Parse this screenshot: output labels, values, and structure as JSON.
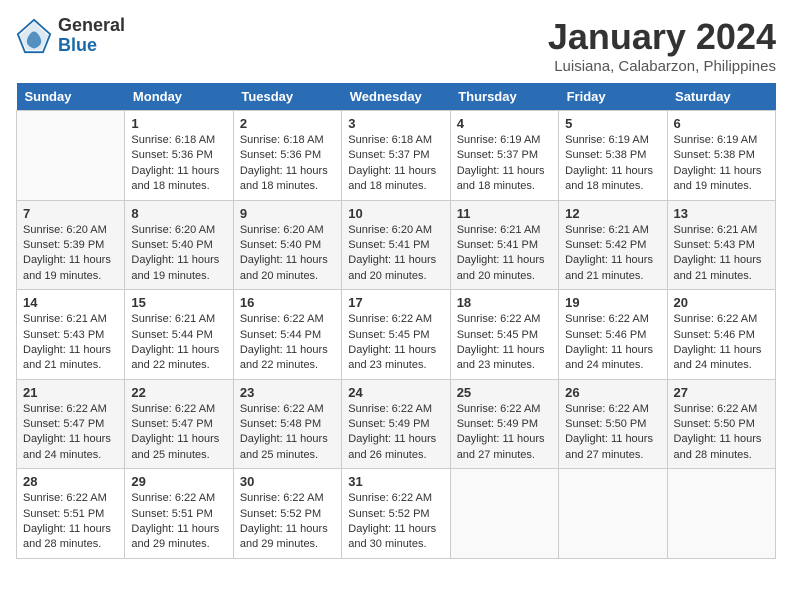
{
  "header": {
    "logo_general": "General",
    "logo_blue": "Blue",
    "title": "January 2024",
    "subtitle": "Luisiana, Calabarzon, Philippines"
  },
  "days_of_week": [
    "Sunday",
    "Monday",
    "Tuesday",
    "Wednesday",
    "Thursday",
    "Friday",
    "Saturday"
  ],
  "weeks": [
    [
      {
        "day": "",
        "info": ""
      },
      {
        "day": "1",
        "info": "Sunrise: 6:18 AM\nSunset: 5:36 PM\nDaylight: 11 hours\nand 18 minutes."
      },
      {
        "day": "2",
        "info": "Sunrise: 6:18 AM\nSunset: 5:36 PM\nDaylight: 11 hours\nand 18 minutes."
      },
      {
        "day": "3",
        "info": "Sunrise: 6:18 AM\nSunset: 5:37 PM\nDaylight: 11 hours\nand 18 minutes."
      },
      {
        "day": "4",
        "info": "Sunrise: 6:19 AM\nSunset: 5:37 PM\nDaylight: 11 hours\nand 18 minutes."
      },
      {
        "day": "5",
        "info": "Sunrise: 6:19 AM\nSunset: 5:38 PM\nDaylight: 11 hours\nand 18 minutes."
      },
      {
        "day": "6",
        "info": "Sunrise: 6:19 AM\nSunset: 5:38 PM\nDaylight: 11 hours\nand 19 minutes."
      }
    ],
    [
      {
        "day": "7",
        "info": "Sunrise: 6:20 AM\nSunset: 5:39 PM\nDaylight: 11 hours\nand 19 minutes."
      },
      {
        "day": "8",
        "info": "Sunrise: 6:20 AM\nSunset: 5:40 PM\nDaylight: 11 hours\nand 19 minutes."
      },
      {
        "day": "9",
        "info": "Sunrise: 6:20 AM\nSunset: 5:40 PM\nDaylight: 11 hours\nand 20 minutes."
      },
      {
        "day": "10",
        "info": "Sunrise: 6:20 AM\nSunset: 5:41 PM\nDaylight: 11 hours\nand 20 minutes."
      },
      {
        "day": "11",
        "info": "Sunrise: 6:21 AM\nSunset: 5:41 PM\nDaylight: 11 hours\nand 20 minutes."
      },
      {
        "day": "12",
        "info": "Sunrise: 6:21 AM\nSunset: 5:42 PM\nDaylight: 11 hours\nand 21 minutes."
      },
      {
        "day": "13",
        "info": "Sunrise: 6:21 AM\nSunset: 5:43 PM\nDaylight: 11 hours\nand 21 minutes."
      }
    ],
    [
      {
        "day": "14",
        "info": "Sunrise: 6:21 AM\nSunset: 5:43 PM\nDaylight: 11 hours\nand 21 minutes."
      },
      {
        "day": "15",
        "info": "Sunrise: 6:21 AM\nSunset: 5:44 PM\nDaylight: 11 hours\nand 22 minutes."
      },
      {
        "day": "16",
        "info": "Sunrise: 6:22 AM\nSunset: 5:44 PM\nDaylight: 11 hours\nand 22 minutes."
      },
      {
        "day": "17",
        "info": "Sunrise: 6:22 AM\nSunset: 5:45 PM\nDaylight: 11 hours\nand 23 minutes."
      },
      {
        "day": "18",
        "info": "Sunrise: 6:22 AM\nSunset: 5:45 PM\nDaylight: 11 hours\nand 23 minutes."
      },
      {
        "day": "19",
        "info": "Sunrise: 6:22 AM\nSunset: 5:46 PM\nDaylight: 11 hours\nand 24 minutes."
      },
      {
        "day": "20",
        "info": "Sunrise: 6:22 AM\nSunset: 5:46 PM\nDaylight: 11 hours\nand 24 minutes."
      }
    ],
    [
      {
        "day": "21",
        "info": "Sunrise: 6:22 AM\nSunset: 5:47 PM\nDaylight: 11 hours\nand 24 minutes."
      },
      {
        "day": "22",
        "info": "Sunrise: 6:22 AM\nSunset: 5:47 PM\nDaylight: 11 hours\nand 25 minutes."
      },
      {
        "day": "23",
        "info": "Sunrise: 6:22 AM\nSunset: 5:48 PM\nDaylight: 11 hours\nand 25 minutes."
      },
      {
        "day": "24",
        "info": "Sunrise: 6:22 AM\nSunset: 5:49 PM\nDaylight: 11 hours\nand 26 minutes."
      },
      {
        "day": "25",
        "info": "Sunrise: 6:22 AM\nSunset: 5:49 PM\nDaylight: 11 hours\nand 27 minutes."
      },
      {
        "day": "26",
        "info": "Sunrise: 6:22 AM\nSunset: 5:50 PM\nDaylight: 11 hours\nand 27 minutes."
      },
      {
        "day": "27",
        "info": "Sunrise: 6:22 AM\nSunset: 5:50 PM\nDaylight: 11 hours\nand 28 minutes."
      }
    ],
    [
      {
        "day": "28",
        "info": "Sunrise: 6:22 AM\nSunset: 5:51 PM\nDaylight: 11 hours\nand 28 minutes."
      },
      {
        "day": "29",
        "info": "Sunrise: 6:22 AM\nSunset: 5:51 PM\nDaylight: 11 hours\nand 29 minutes."
      },
      {
        "day": "30",
        "info": "Sunrise: 6:22 AM\nSunset: 5:52 PM\nDaylight: 11 hours\nand 29 minutes."
      },
      {
        "day": "31",
        "info": "Sunrise: 6:22 AM\nSunset: 5:52 PM\nDaylight: 11 hours\nand 30 minutes."
      },
      {
        "day": "",
        "info": ""
      },
      {
        "day": "",
        "info": ""
      },
      {
        "day": "",
        "info": ""
      }
    ]
  ]
}
